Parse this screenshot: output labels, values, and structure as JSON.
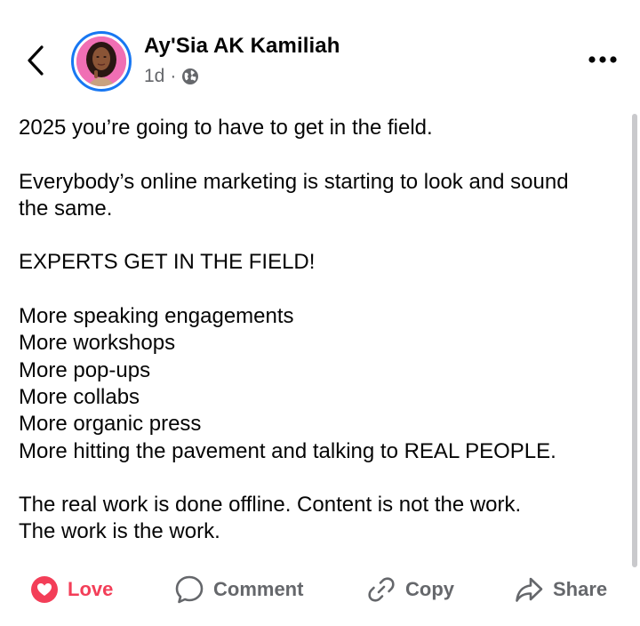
{
  "post": {
    "author": "Ay'Sia AK Kamiliah",
    "time": "1d",
    "separator": "·",
    "privacy_icon": "globe-icon",
    "body": {
      "line1": "2025 you’re going to have to get in the field.",
      "line2a": "Everybody’s online marketing is starting to look and sound",
      "line2b": "the same.",
      "line3": "EXPERTS GET IN THE FIELD!",
      "list": [
        "More speaking engagements",
        "More workshops",
        "More pop-ups",
        "More collabs",
        "More organic press",
        "More hitting the pavement and talking to REAL PEOPLE."
      ],
      "closing1": "The real work is done offline. Content is not the work.",
      "closing2": "The work is the work."
    }
  },
  "actions": {
    "love": "Love",
    "comment": "Comment",
    "copy": "Copy",
    "share": "Share"
  },
  "colors": {
    "accent": "#1877f2",
    "love": "#f33e58",
    "muted": "#65676b",
    "text": "#050505"
  },
  "icons": {
    "back": "chevron-left-icon",
    "more": "more-dots-icon",
    "love": "love-reaction-icon",
    "comment": "comment-bubble-icon",
    "copy": "link-icon",
    "share": "share-arrow-icon"
  }
}
